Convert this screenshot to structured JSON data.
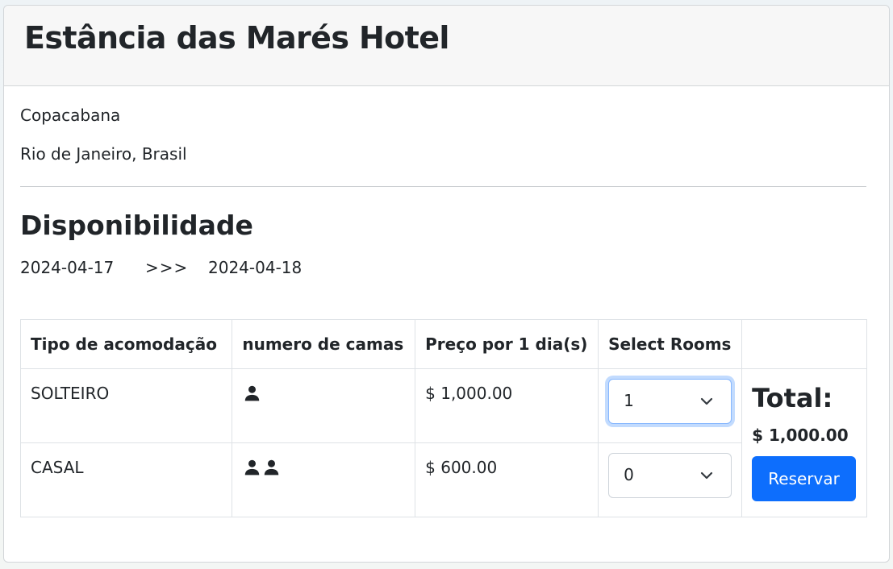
{
  "hotel": {
    "name": "Estância das Marés Hotel",
    "neighborhood": "Copacabana",
    "city": "Rio de Janeiro, Brasil"
  },
  "availability": {
    "title": "Disponibilidade",
    "date_from": "2024-04-17",
    "arrow": ">>>",
    "date_to": "2024-04-18"
  },
  "table": {
    "headers": [
      "Tipo de acomodação",
      "numero de camas",
      "Preço por 1 dia(s)",
      "Select Rooms",
      ""
    ],
    "rows": [
      {
        "type": "SOLTEIRO",
        "beds": 1,
        "price": "$ 1,000.00",
        "selected": "1"
      },
      {
        "type": "CASAL",
        "beds": 2,
        "price": "$ 600.00",
        "selected": "0"
      }
    ]
  },
  "summary": {
    "total_label": "Total:",
    "total_value": "$ 1,000.00",
    "reserve_label": "Reservar"
  },
  "icons": {
    "bed": "person-icon",
    "dropdown": "chevron-down-icon"
  },
  "colors": {
    "primary": "#0d6efd",
    "focus": "#86b7fe"
  }
}
